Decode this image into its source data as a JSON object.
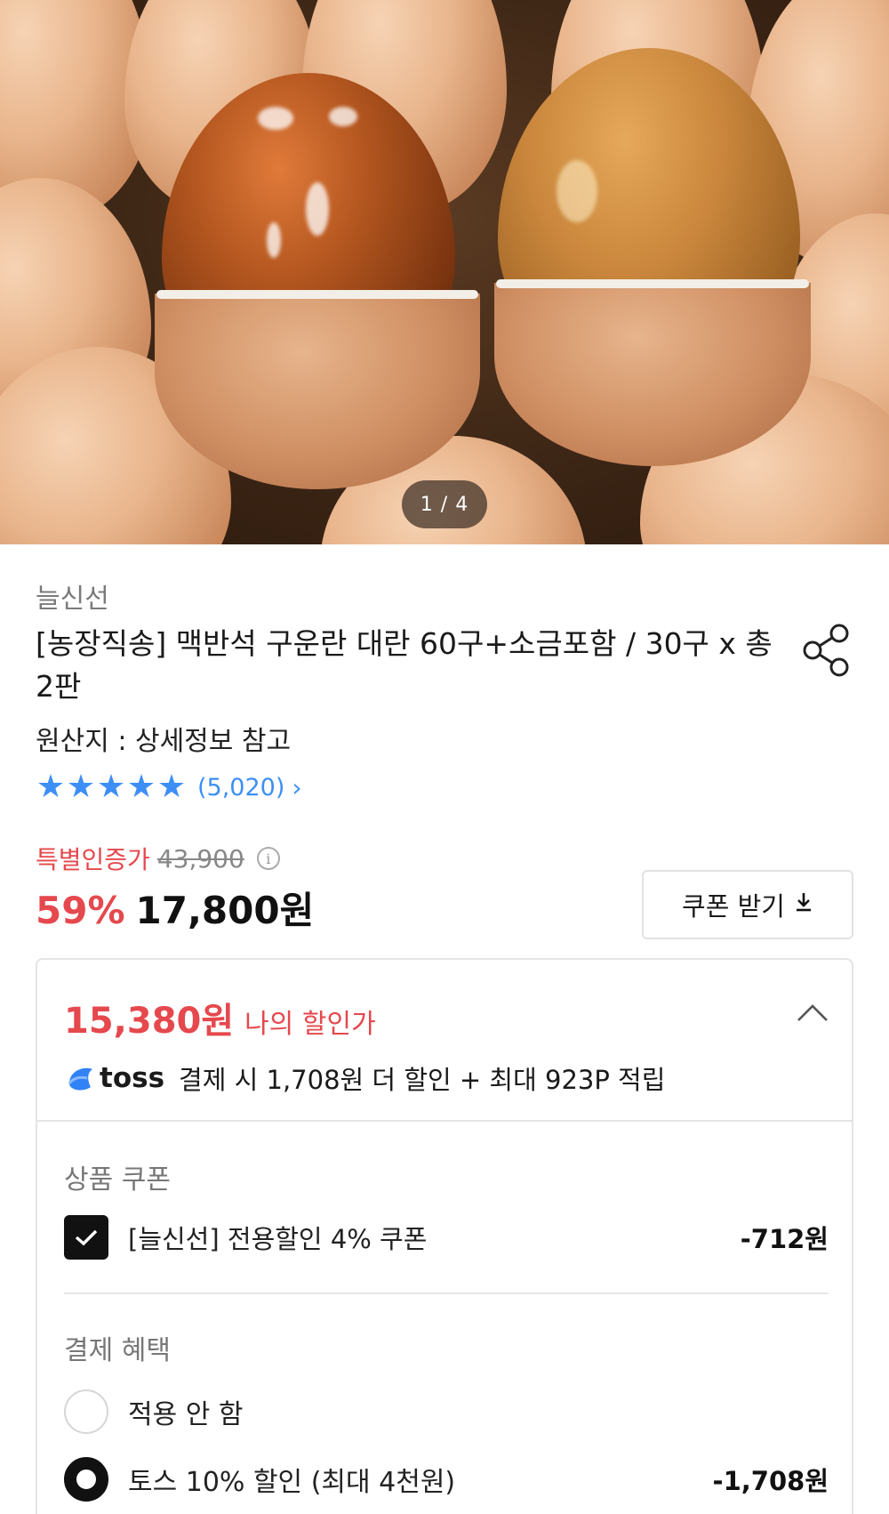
{
  "gallery": {
    "pager": "1 / 4"
  },
  "product": {
    "seller": "늘신선",
    "title": "[농장직송] 맥반석 구운란 대란 60구+소금포함 / 30구 x 총 2판",
    "origin": "원산지 : 상세정보 참고",
    "rating": {
      "stars": 5,
      "reviews": "(5,020)"
    },
    "special_price_label": "특별인증가",
    "original_price": "43,900",
    "discount_rate": "59%",
    "sale_price": "17,800원",
    "coupon_button": "쿠폰 받기"
  },
  "discount_card": {
    "my_price": "15,380원",
    "my_price_label": "나의 할인가",
    "toss_brand": "toss",
    "toss_text": "결제 시 1,708원 더 할인 + 최대 923P 적립",
    "product_coupon": {
      "section": "상품 쿠폰",
      "name": "[늘신선] 전용할인 4% 쿠폰",
      "amount": "-712원",
      "checked": true
    },
    "payment_benefit": {
      "section": "결제 혜택",
      "options": [
        {
          "label": "적용 안 함",
          "amount": "",
          "selected": false
        },
        {
          "label": "토스 10% 할인 (최대 4천원)",
          "amount": "-1,708원",
          "selected": true
        }
      ]
    }
  },
  "colors": {
    "accent_red": "#e5484d",
    "star_blue": "#3d8ff5",
    "toss_blue": "#3182f6"
  },
  "icons": [
    "share-icon",
    "star-icon",
    "chevron-right-icon",
    "info-icon",
    "download-icon",
    "chevron-up-icon",
    "toss-logo-icon",
    "check-icon"
  ]
}
